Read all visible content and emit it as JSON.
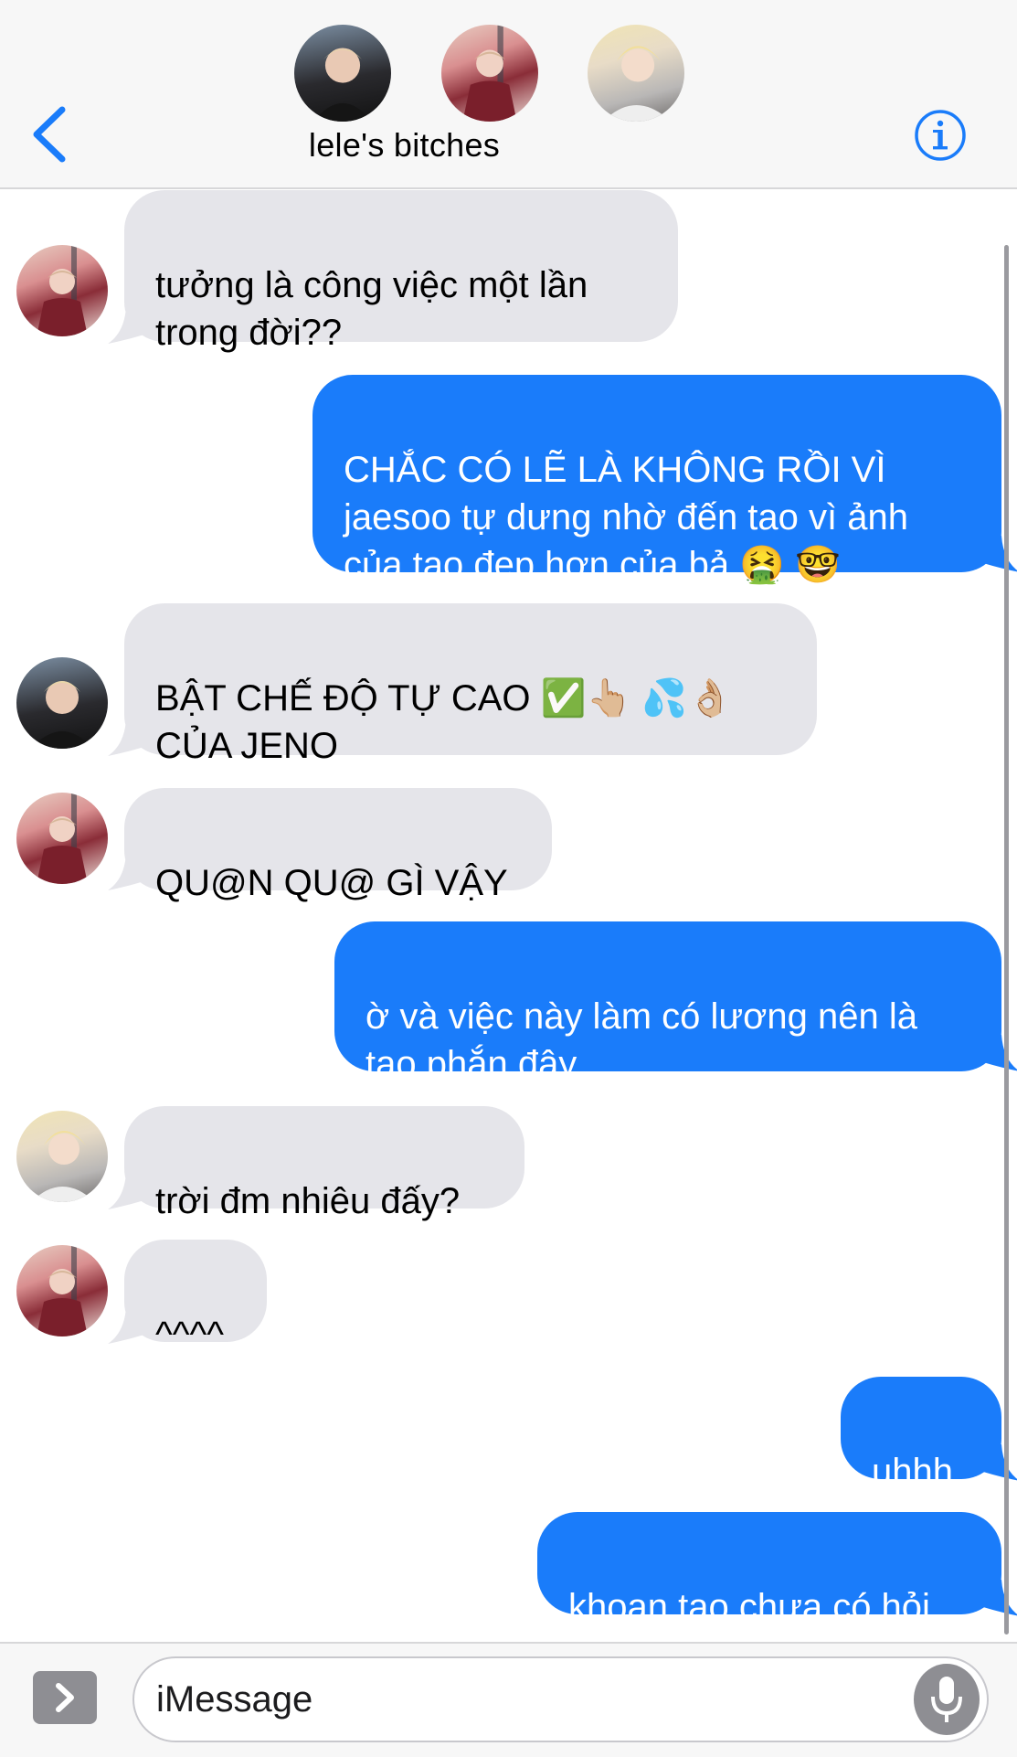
{
  "header": {
    "group_name": "lele's bitches",
    "back_icon": "chevron-left-icon",
    "info_icon": "info-circle-icon",
    "accent": "#1a7cfa"
  },
  "messages": [
    {
      "direction": "incoming",
      "sender_avatar": "avatar-a",
      "text": "tưởng là công việc một lần\ntrong đời??"
    },
    {
      "direction": "outgoing",
      "text": "CHẮC CÓ LẼ LÀ KHÔNG RỒI VÌ\njaesoo tự dưng nhờ đến tao vì ảnh\ncủa tao đẹp hơn của bả 🤮 🤓"
    },
    {
      "direction": "incoming",
      "sender_avatar": "avatar-b",
      "text": "BẬT CHẾ ĐỘ TỰ CAO ✅👆🏼 💦👌🏼\nCỦA JENO"
    },
    {
      "direction": "incoming",
      "sender_avatar": "avatar-a",
      "text": "QU@N QU@ GÌ VẬY"
    },
    {
      "direction": "outgoing",
      "text": "ờ và việc này làm có lương nên là\ntao phắn đây"
    },
    {
      "direction": "incoming",
      "sender_avatar": "avatar-c",
      "text": "trời đm nhiêu đấy?"
    },
    {
      "direction": "incoming",
      "sender_avatar": "avatar-a",
      "text": "^^^^"
    },
    {
      "direction": "outgoing",
      "text": "uhhh"
    },
    {
      "direction": "outgoing",
      "text": "khoan tao chưa có hỏi"
    }
  ],
  "composer": {
    "placeholder": "iMessage",
    "apps_icon": "chevron-right-icon",
    "mic_icon": "microphone-icon"
  },
  "colors": {
    "incoming_bubble": "#e5e5ea",
    "outgoing_bubble": "#1a7cfa",
    "header_bg": "#f7f7f7"
  }
}
